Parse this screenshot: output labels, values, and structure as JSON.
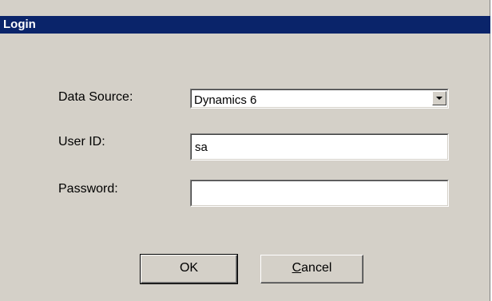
{
  "window": {
    "title": "Login"
  },
  "form": {
    "data_source_label": "Data Source:",
    "data_source_value": "Dynamics 6",
    "user_id_label": "User ID:",
    "user_id_value": "sa",
    "password_label": "Password:",
    "password_value": ""
  },
  "buttons": {
    "ok_label": "OK",
    "cancel_mnemonic": "C",
    "cancel_rest": "ancel"
  },
  "colors": {
    "titlebar": "#0a246a",
    "dialog_face": "#d4d0c8"
  },
  "icons": {
    "dropdown": "chevron-down-icon"
  }
}
